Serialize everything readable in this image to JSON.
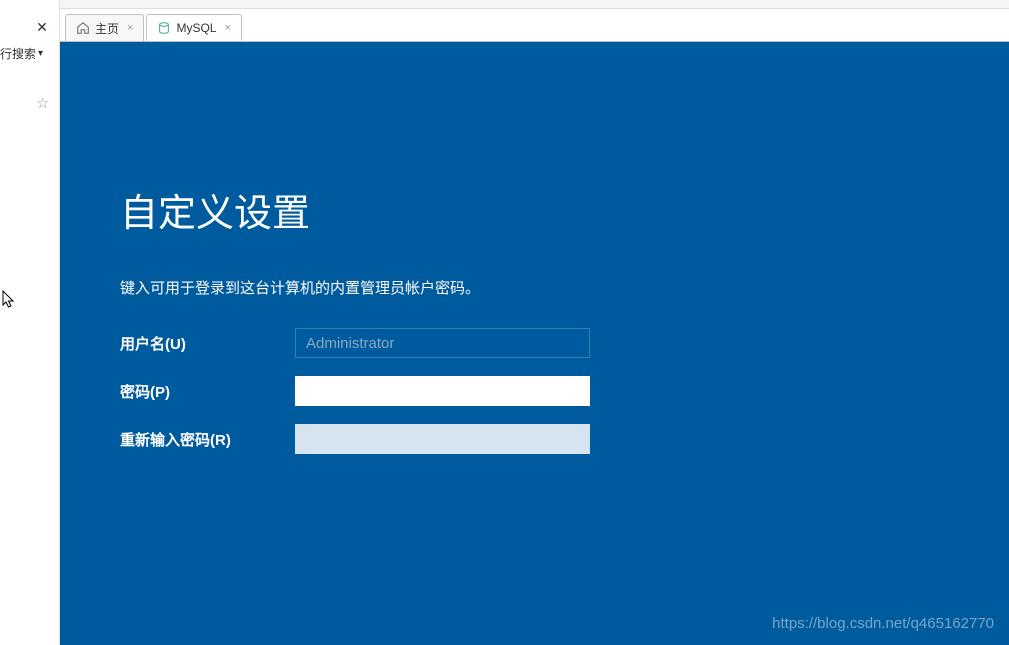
{
  "leftPanel": {
    "closeSymbol": "✕",
    "searchLabel": "行搜索",
    "starSymbol": "☆"
  },
  "tabs": [
    {
      "label": "主页",
      "closeSymbol": "×"
    },
    {
      "label": "MySQL",
      "closeSymbol": "×"
    }
  ],
  "setup": {
    "title": "自定义设置",
    "subtitle": "键入可用于登录到这台计算机的内置管理员帐户密码。",
    "usernameLabel": "用户名(U)",
    "usernameValue": "Administrator",
    "passwordLabel": "密码(P)",
    "passwordValue": "",
    "confirmLabel": "重新输入密码(R)",
    "confirmValue": ""
  },
  "watermark": "https://blog.csdn.net/q465162770"
}
